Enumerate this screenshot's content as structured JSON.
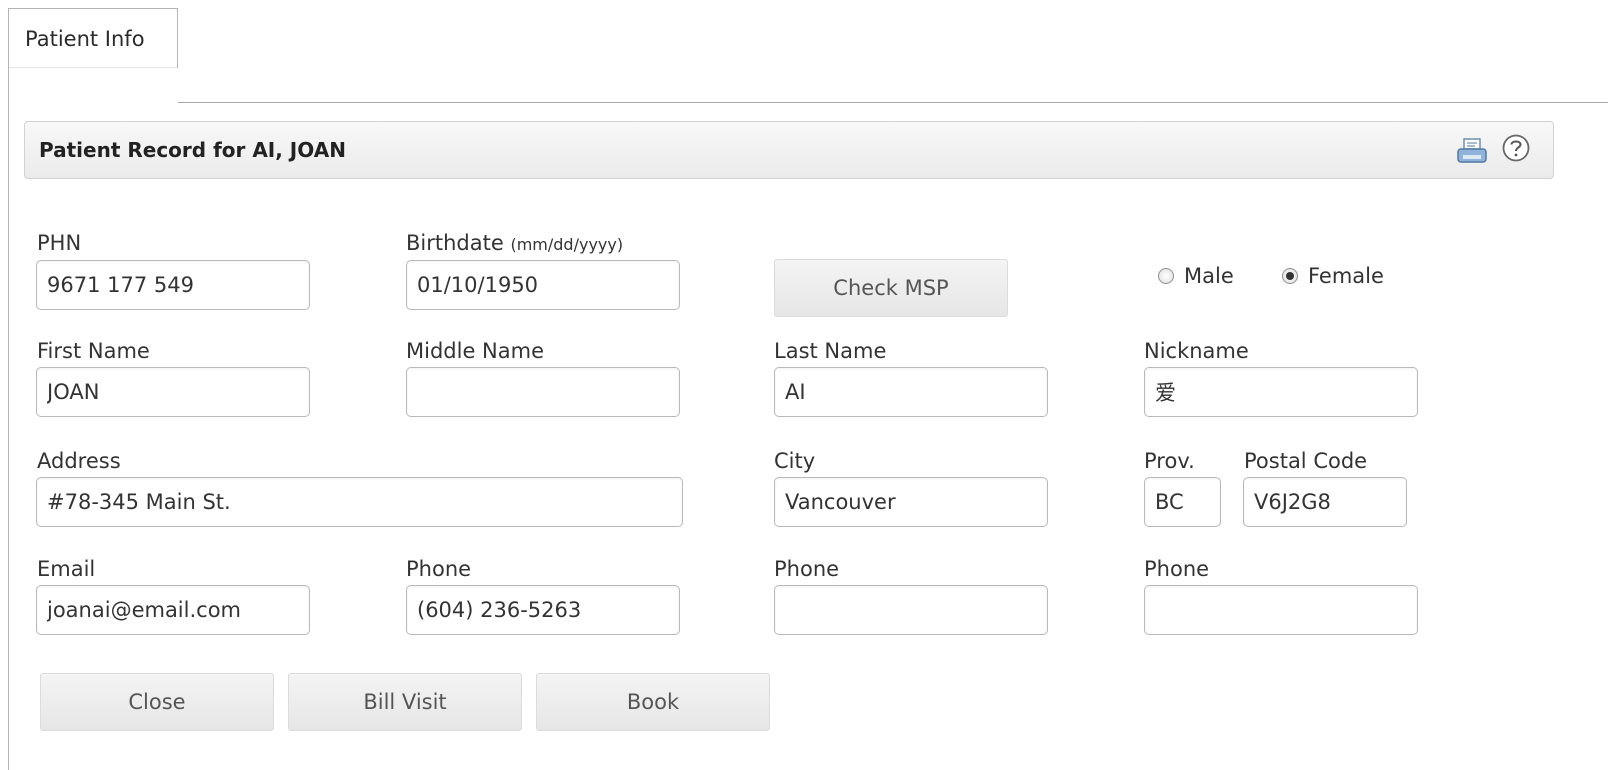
{
  "tab": {
    "label": "Patient Info"
  },
  "header": {
    "title": "Patient Record for AI, JOAN"
  },
  "labels": {
    "phn": "PHN",
    "birthdate": "Birthdate",
    "birthdate_format": "(mm/dd/yyyy)",
    "first_name": "First Name",
    "middle_name": "Middle Name",
    "last_name": "Last Name",
    "nickname": "Nickname",
    "address": "Address",
    "city": "City",
    "prov": "Prov.",
    "postal_code": "Postal Code",
    "email": "Email",
    "phone1": "Phone",
    "phone2": "Phone",
    "phone3": "Phone"
  },
  "values": {
    "phn": "9671 177 549",
    "birthdate": "01/10/1950",
    "first_name": "JOAN",
    "middle_name": "",
    "last_name": "AI",
    "nickname": "爱",
    "address": "#78-345 Main St.",
    "city": "Vancouver",
    "prov": "BC",
    "postal_code": "V6J2G8",
    "email": "joanai@email.com",
    "phone1": "(604) 236-5263",
    "phone2": "",
    "phone3": ""
  },
  "gender": {
    "male_label": "Male",
    "female_label": "Female",
    "selected": "Female"
  },
  "buttons": {
    "check_msp": "Check MSP",
    "close": "Close",
    "bill_visit": "Bill Visit",
    "book": "Book"
  },
  "icons": {
    "print": "print-icon",
    "help": "help-icon"
  }
}
